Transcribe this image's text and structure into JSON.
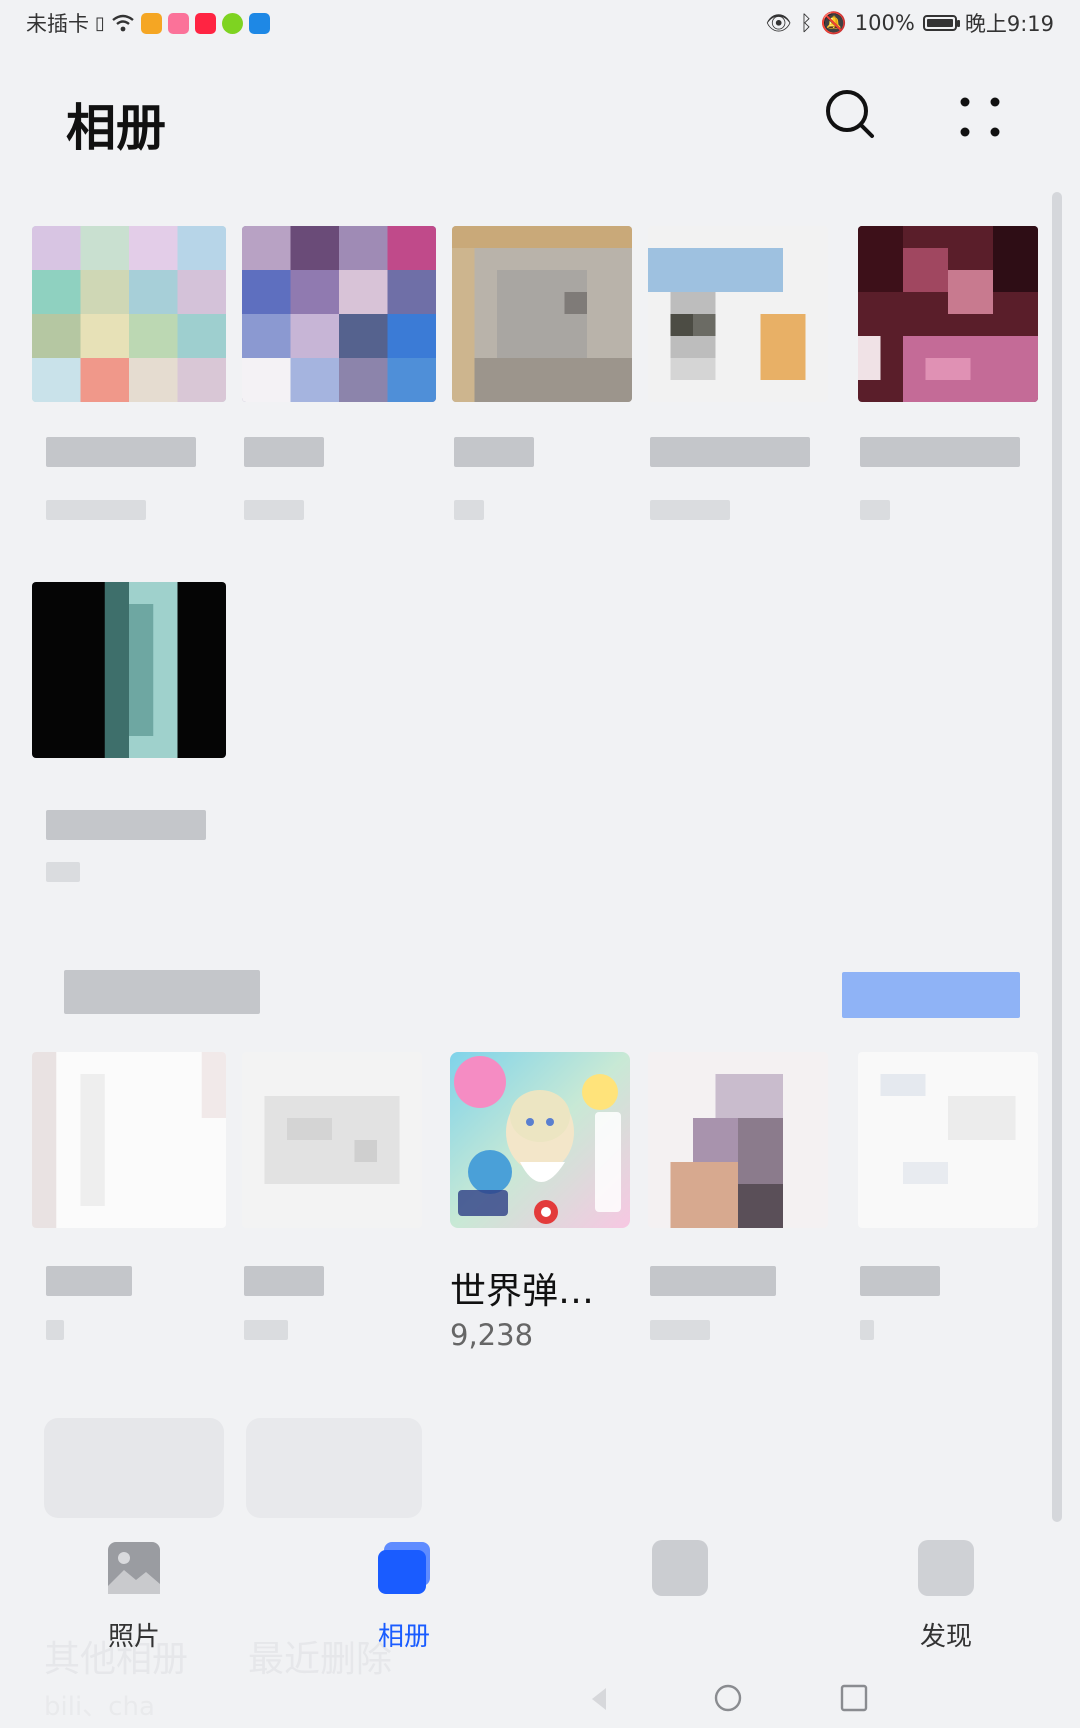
{
  "status_bar": {
    "carrier": "未插卡",
    "battery": "100%",
    "battery_level": 1.0,
    "time": "晚上9:19"
  },
  "header": {
    "title": "相册",
    "search_icon": "search-icon",
    "more_icon": "more-icon"
  },
  "visible_album": {
    "title": "世界弹…",
    "count": "9,238"
  },
  "ghost_albums": {
    "other_label": "其他相册",
    "other_sub": "bili、cha",
    "recent_label": "最近删除"
  },
  "bottom_nav": {
    "items": [
      {
        "label": "照片",
        "icon": "photos-icon",
        "active": false
      },
      {
        "label": "相册",
        "icon": "albums-icon",
        "active": true
      },
      {
        "label": "",
        "icon": "moments-icon",
        "active": false
      },
      {
        "label": "发现",
        "icon": "discover-icon",
        "active": false
      }
    ]
  },
  "colors": {
    "accent": "#1a5cff",
    "background": "#f1f2f4"
  }
}
